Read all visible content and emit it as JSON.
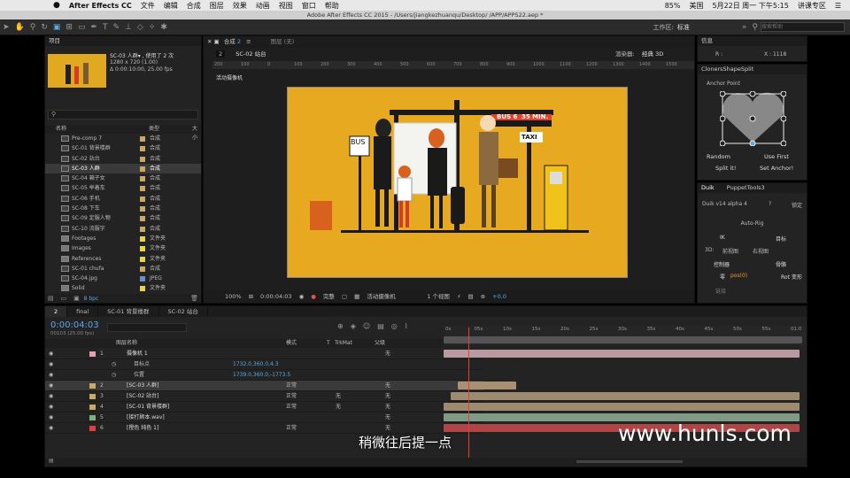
{
  "menubar": {
    "apple": "",
    "app": "After Effects CC",
    "items": [
      "文件",
      "编辑",
      "合成",
      "图层",
      "效果",
      "动画",
      "视图",
      "窗口",
      "帮助"
    ],
    "battery": "85%",
    "lang": "美国",
    "datetime": "5月22日 周一 下午5:15",
    "user": "讲课专区"
  },
  "titlebar": "Adobe After Effects CC 2015 - /Users/jiangkezhuanqu/Desktop/ /APP/APPS22.aep *",
  "toolbar": {
    "workspace_label": "工作区:",
    "workspace_value": "标准",
    "search_placeholder": "搜索帮助"
  },
  "project": {
    "title": "项目",
    "selected_name": "SC-03 人群▾ , 使用了 2 次",
    "resolution": "1280 x 720 (1.00)",
    "duration": "Δ 0:00:10:00, 25.00 fps",
    "col_name": "名称",
    "col_type": "类型",
    "col_size": "大小",
    "items": [
      {
        "name": "Pre-comp 7",
        "type": "合成",
        "color": "#c9a868",
        "kind": "comp"
      },
      {
        "name": "SC-01 背景楼群",
        "type": "合成",
        "color": "#c9a868",
        "kind": "comp"
      },
      {
        "name": "SC-02 站台",
        "type": "合成",
        "color": "#c9a868",
        "kind": "comp"
      },
      {
        "name": "SC-03 人群",
        "type": "合成",
        "color": "#c9a868",
        "kind": "comp",
        "selected": true
      },
      {
        "name": "SC-04 箱子女",
        "type": "合成",
        "color": "#c9a868",
        "kind": "comp"
      },
      {
        "name": "SC-05 举着车",
        "type": "合成",
        "color": "#c9a868",
        "kind": "comp"
      },
      {
        "name": "SC-06 手机",
        "type": "合成",
        "color": "#c9a868",
        "kind": "comp"
      },
      {
        "name": "SC-08 下车",
        "type": "合成",
        "color": "#c9a868",
        "kind": "comp"
      },
      {
        "name": "SC-09 定服人物",
        "type": "合成",
        "color": "#c9a868",
        "kind": "comp"
      },
      {
        "name": "SC-10 流服字",
        "type": "合成",
        "color": "#c9a868",
        "kind": "comp"
      },
      {
        "name": "Footages",
        "type": "文件夹",
        "color": "#e8d44d",
        "kind": "folder"
      },
      {
        "name": "Images",
        "type": "文件夹",
        "color": "#e8d44d",
        "kind": "folder"
      },
      {
        "name": "References",
        "type": "文件夹",
        "color": "#e8d44d",
        "kind": "folder"
      },
      {
        "name": "SC-01 chufa",
        "type": "合成",
        "color": "#c9a868",
        "kind": "comp"
      },
      {
        "name": "SC-04.jpg",
        "type": "JPEG",
        "color": "#6b8fc9",
        "kind": "file"
      },
      {
        "name": "Solid",
        "type": "文件夹",
        "color": "#e8d44d",
        "kind": "folder"
      }
    ],
    "bpc": "8 bpc"
  },
  "composition": {
    "tab_label": "合成",
    "tab_name": "2",
    "layer_tab": "图层 (无)",
    "breadcrumb_num": "2",
    "breadcrumb_name": "SC-02 站台",
    "renderer_label": "渲染器:",
    "renderer_value": "经典 3D",
    "camera_label": "活动摄像机",
    "ruler": [
      "200",
      "100",
      "0",
      "100",
      "200",
      "300",
      "400",
      "500",
      "600",
      "700",
      "800",
      "900",
      "1000",
      "1100",
      "1200",
      "1300",
      "1400",
      "1500"
    ],
    "footer": {
      "zoom": "100%",
      "time": "0:00:04:03",
      "quality": "完整",
      "view": "活动摄像机",
      "views": "1 个视图",
      "exposure": "+0.0"
    },
    "scene_text": {
      "bus": "BUS",
      "bus6": "BUS 6",
      "min": "35 MIN.",
      "taxi": "TAXI"
    }
  },
  "info": {
    "title": "信息",
    "r": "R :",
    "x": "X : 1118"
  },
  "cloners": {
    "title": "ClonersShapeSplit",
    "anchor": "Anchor Point",
    "random": "Random",
    "use_first": "Use First",
    "split": "Split it!",
    "set_anchor": "Set Anchor!"
  },
  "duik": {
    "tab1": "Duik",
    "tab2": "PuppetTools3",
    "version": "Duik v14 alpha 4",
    "q": "?",
    "lock": "锁定",
    "autorig": "Auto-Rig",
    "ik": "IK",
    "goal": "目标",
    "threeD": "3D:",
    "front": "前视图",
    "right": "右视图",
    "controllers": "控制器",
    "bones": "骨骼",
    "zero": "零",
    "pos": "pos(0)",
    "rot": "Rot 变形",
    "link": "链接"
  },
  "timeline": {
    "tabs": [
      "2",
      "final",
      "SC-01 背景楼群",
      "SC-02 站台"
    ],
    "time": "0:00:04:03",
    "fps": "00103 (25.00 fps)",
    "search_placeholder": "",
    "headers": {
      "name": "图层名称",
      "mode": "模式",
      "t": "T",
      "trkmat": "TrkMat",
      "parent": "父级"
    },
    "ruler": [
      "0s",
      "05s",
      "10s",
      "15s",
      "20s",
      "25s",
      "30s",
      "35s",
      "40s",
      "45s",
      "50s",
      "55s",
      "01:0"
    ],
    "layers": [
      {
        "num": "1",
        "name": "摄像机 1",
        "label": "#e8a0b0",
        "mode": "",
        "trk": "",
        "parent": "无",
        "type": "camera"
      },
      {
        "num": "",
        "name": "目标点",
        "value": "1732.0,360.0,4.3",
        "type": "prop"
      },
      {
        "num": "",
        "name": "位置",
        "value": "1739.0,360.0,-1773.5",
        "type": "prop"
      },
      {
        "num": "2",
        "name": "[SC-03 人群]",
        "label": "#c9a868",
        "mode": "正常",
        "trk": "",
        "parent": "无",
        "type": "comp",
        "selected": true
      },
      {
        "num": "3",
        "name": "[SC-02 站台]",
        "label": "#c9a868",
        "mode": "正常",
        "trk": "无",
        "parent": "无",
        "type": "comp"
      },
      {
        "num": "4",
        "name": "[SC-01 背景楼群]",
        "label": "#c9a868",
        "mode": "正常",
        "trk": "无",
        "parent": "无",
        "type": "comp"
      },
      {
        "num": "5",
        "name": "[接打顾本.wav]",
        "label": "#7fb07f",
        "mode": "",
        "trk": "",
        "parent": "无",
        "type": "audio"
      },
      {
        "num": "6",
        "name": "[橙色 纯色 1]",
        "label": "#e04040",
        "mode": "正常",
        "trk": "",
        "parent": "无",
        "type": "solid"
      }
    ],
    "bars": [
      {
        "color": "#b89aa0",
        "from": 0.0,
        "to": 0.98
      },
      {
        "color": "",
        "from": 0,
        "to": 0
      },
      {
        "color": "",
        "from": 0,
        "to": 0
      },
      {
        "color": "#a89070",
        "from": 0.04,
        "to": 0.2
      },
      {
        "color": "#9e8a6e",
        "from": 0.02,
        "to": 0.98
      },
      {
        "color": "#9e8a6e",
        "from": 0.0,
        "to": 0.98
      },
      {
        "color": "#7f9a85",
        "from": 0.0,
        "to": 0.98
      },
      {
        "color": "#b04545",
        "from": 0.0,
        "to": 0.98
      }
    ]
  },
  "subtitle": "稍微往后提一点",
  "watermark": "www.hunls.com"
}
